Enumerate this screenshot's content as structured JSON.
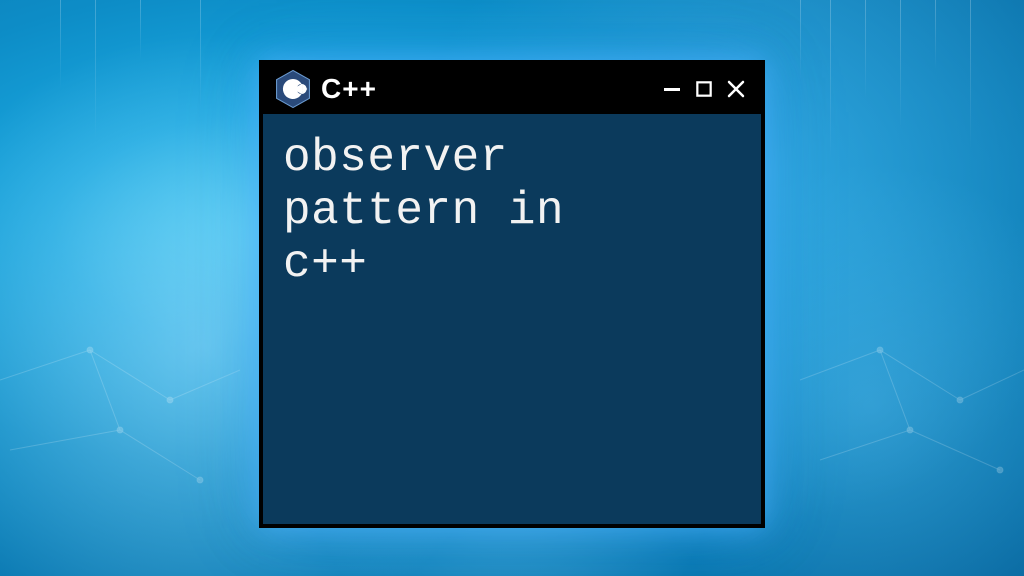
{
  "window": {
    "title": "C++",
    "logo": "cpp-hex-logo",
    "controls": {
      "minimize": "—",
      "maximize": "☐",
      "close": "✕"
    }
  },
  "body": {
    "text": "observer\npattern in\nc++"
  },
  "colors": {
    "titlebar_bg": "#000000",
    "window_bg": "#0b3a5c",
    "text": "#f2f2f2",
    "accent_glow": "#4dd0f5"
  }
}
